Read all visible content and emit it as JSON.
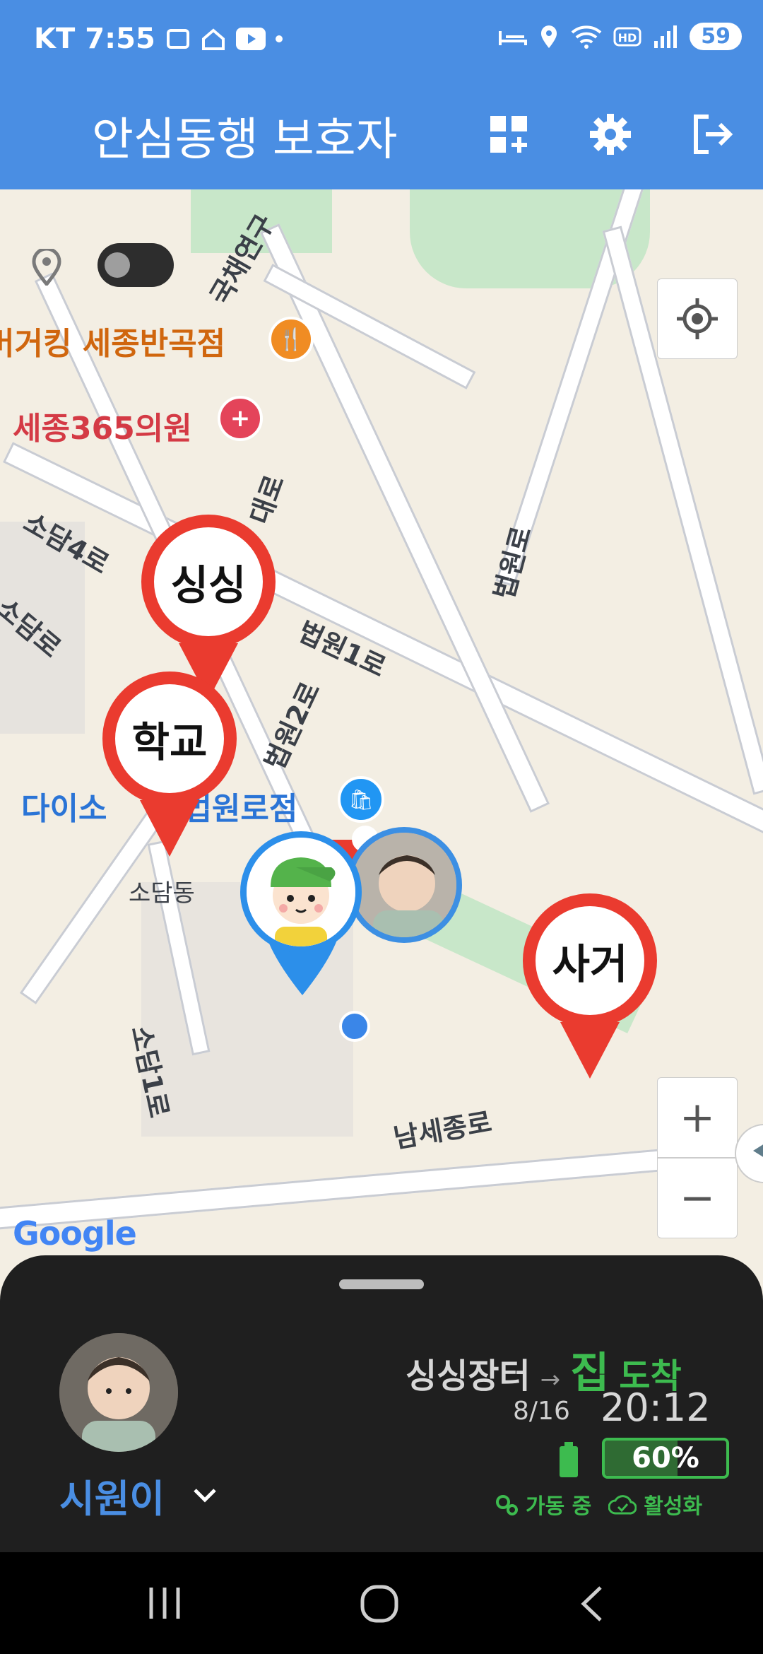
{
  "status_bar": {
    "carrier": "KT",
    "time": "7:55",
    "battery_level": "59"
  },
  "header": {
    "title": "안심동행 보호자",
    "icons": [
      "widget-add-icon",
      "gear-icon",
      "logout-icon"
    ]
  },
  "map": {
    "streets": [
      "국채연구",
      "소담4로",
      "소담로",
      "법원1로",
      "법원2로",
      "법원로",
      "대로",
      "소담1로",
      "남세종로"
    ],
    "district": "소담동",
    "pois": {
      "burger": "버거킹 세종반곡점",
      "clinic": "세종365의원",
      "daiso_a": "다이소",
      "daiso_b": "법원로점"
    },
    "pins": [
      "싱싱",
      "학교",
      "사거"
    ],
    "google_logo": "Google",
    "zoom_in": "+",
    "zoom_out": "−",
    "colors": {
      "pin": "#ea3b2f",
      "accent": "#4a8ee3"
    }
  },
  "sheet": {
    "child_name": "시원이",
    "route_from": "싱싱장터",
    "arrow": "→",
    "route_to": "집",
    "route_status": "도착",
    "date": "8/16",
    "time": "20:12",
    "battery": "60%",
    "running": "가동 중",
    "activated": "활성화",
    "colors": {
      "green": "#3dbb4f",
      "blue": "#4a8ee3"
    }
  }
}
